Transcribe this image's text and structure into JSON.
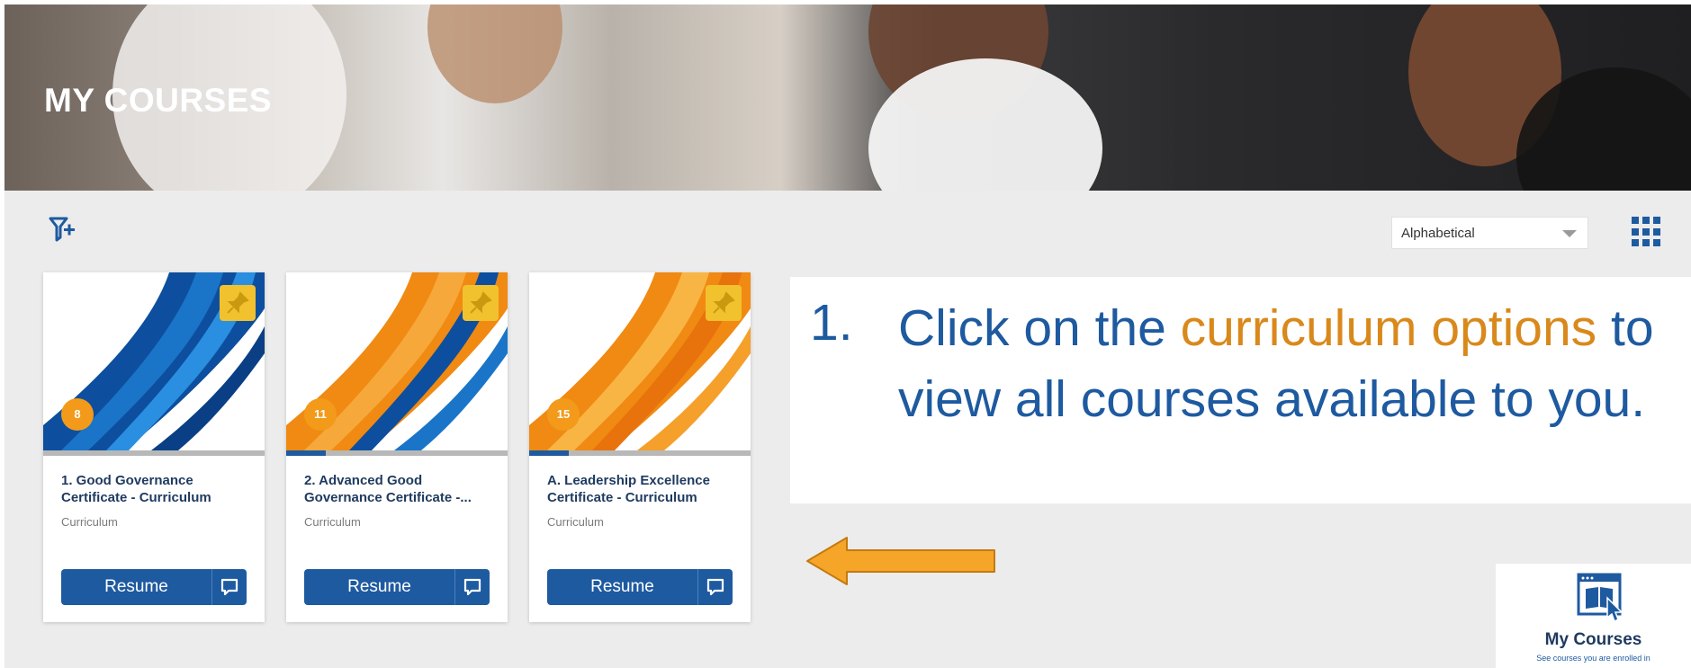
{
  "header": {
    "title": "MY COURSES"
  },
  "toolbar": {
    "filter_icon": "filter-add-icon",
    "sort_value": "Alphabetical",
    "view_icon": "grid-view-icon"
  },
  "courses": [
    {
      "badge": "8",
      "title": "1. Good Governance Certificate - Curriculum",
      "type": "Curriculum",
      "resume_label": "Resume",
      "progress": 0
    },
    {
      "badge": "11",
      "title": "2. Advanced Good Governance Certificate -...",
      "type": "Curriculum",
      "resume_label": "Resume",
      "progress": 0.18
    },
    {
      "badge": "15",
      "title": "A. Leadership Excellence Certificate - Curriculum",
      "type": "Curriculum",
      "resume_label": "Resume",
      "progress": 0.18
    }
  ],
  "instruction": {
    "number": "1.",
    "text_before": "Click on the ",
    "highlight": "curriculum options",
    "text_after": " to view all courses available to you."
  },
  "tile": {
    "title": "My Courses",
    "subtitle": "See courses you are enrolled in"
  },
  "colors": {
    "brand_blue": "#1e5aa0",
    "accent_orange": "#d9891b",
    "badge_orange": "#f39a1a",
    "pin_yellow": "#f2c12e"
  }
}
